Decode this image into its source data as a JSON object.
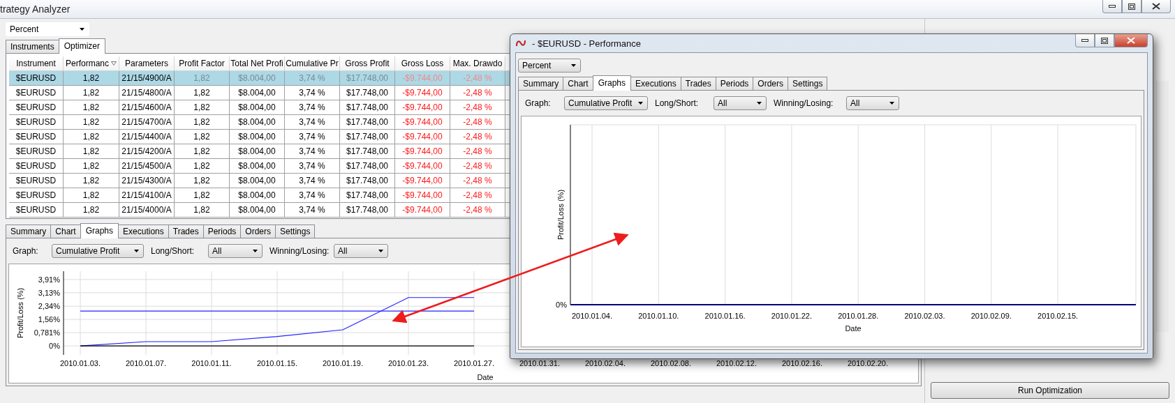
{
  "main_window": {
    "title": "trategy Analyzer",
    "display": "Percent",
    "top_tabs": [
      {
        "label": "Instruments",
        "selected": false
      },
      {
        "label": "Optimizer",
        "selected": true
      }
    ],
    "table": {
      "columns": [
        {
          "label": "Instrument",
          "sorted": false,
          "negative": false
        },
        {
          "label": "Performanc",
          "sorted": true,
          "negative": false
        },
        {
          "label": "Parameters",
          "sorted": false,
          "negative": false
        },
        {
          "label": "Profit Factor",
          "sorted": false,
          "negative": false
        },
        {
          "label": "Total Net Profi",
          "sorted": false,
          "negative": false
        },
        {
          "label": "Cumulative Pr",
          "sorted": false,
          "negative": false
        },
        {
          "label": "Gross Profit",
          "sorted": false,
          "negative": false
        },
        {
          "label": "Gross Loss",
          "sorted": false,
          "negative": true
        },
        {
          "label": "Max. Drawdo",
          "sorted": false,
          "negative": true
        }
      ],
      "rows": [
        {
          "selected": true,
          "cells": [
            "$EURUSD",
            "1,82",
            "21/15/4900/A",
            "1,82",
            "$8.004,00",
            "3,74 %",
            "$17.748,00",
            "-$9.744,00",
            "-2,48 %"
          ]
        },
        {
          "selected": false,
          "cells": [
            "$EURUSD",
            "1,82",
            "21/15/4800/A",
            "1,82",
            "$8.004,00",
            "3,74 %",
            "$17.748,00",
            "-$9.744,00",
            "-2,48 %"
          ]
        },
        {
          "selected": false,
          "cells": [
            "$EURUSD",
            "1,82",
            "21/15/4600/A",
            "1,82",
            "$8.004,00",
            "3,74 %",
            "$17.748,00",
            "-$9.744,00",
            "-2,48 %"
          ]
        },
        {
          "selected": false,
          "cells": [
            "$EURUSD",
            "1,82",
            "21/15/4700/A",
            "1,82",
            "$8.004,00",
            "3,74 %",
            "$17.748,00",
            "-$9.744,00",
            "-2,48 %"
          ]
        },
        {
          "selected": false,
          "cells": [
            "$EURUSD",
            "1,82",
            "21/15/4400/A",
            "1,82",
            "$8.004,00",
            "3,74 %",
            "$17.748,00",
            "-$9.744,00",
            "-2,48 %"
          ]
        },
        {
          "selected": false,
          "cells": [
            "$EURUSD",
            "1,82",
            "21/15/4200/A",
            "1,82",
            "$8.004,00",
            "3,74 %",
            "$17.748,00",
            "-$9.744,00",
            "-2,48 %"
          ]
        },
        {
          "selected": false,
          "cells": [
            "$EURUSD",
            "1,82",
            "21/15/4500/A",
            "1,82",
            "$8.004,00",
            "3,74 %",
            "$17.748,00",
            "-$9.744,00",
            "-2,48 %"
          ]
        },
        {
          "selected": false,
          "cells": [
            "$EURUSD",
            "1,82",
            "21/15/4300/A",
            "1,82",
            "$8.004,00",
            "3,74 %",
            "$17.748,00",
            "-$9.744,00",
            "-2,48 %"
          ]
        },
        {
          "selected": false,
          "cells": [
            "$EURUSD",
            "1,82",
            "21/15/4100/A",
            "1,82",
            "$8.004,00",
            "3,74 %",
            "$17.748,00",
            "-$9.744,00",
            "-2,48 %"
          ]
        },
        {
          "selected": false,
          "cells": [
            "$EURUSD",
            "1,82",
            "21/15/4000/A",
            "1,82",
            "$8.004,00",
            "3,74 %",
            "$17.748,00",
            "-$9.744,00",
            "-2,48 %"
          ]
        }
      ]
    },
    "bottom_tabs": [
      {
        "label": "Summary",
        "selected": false
      },
      {
        "label": "Chart",
        "selected": false
      },
      {
        "label": "Graphs",
        "selected": true
      },
      {
        "label": "Executions",
        "selected": false
      },
      {
        "label": "Trades",
        "selected": false
      },
      {
        "label": "Periods",
        "selected": false
      },
      {
        "label": "Orders",
        "selected": false
      },
      {
        "label": "Settings",
        "selected": false
      }
    ],
    "filters": [
      {
        "label": "Graph:",
        "value": "Cumulative Profit"
      },
      {
        "label": "Long/Short:",
        "value": "All"
      },
      {
        "label": "Winning/Losing:",
        "value": "All"
      }
    ],
    "chart": {
      "chart_data": {
        "type": "line",
        "xlabel": "Date",
        "ylabel": "Profit/Loss (%)",
        "grid": true,
        "x": [
          "2010.01.03.",
          "2010.01.07.",
          "2010.01.11.",
          "2010.01.15.",
          "2010.01.19.",
          "2010.01.23.",
          "2010.01.27.",
          "2010.01.31.",
          "2010.02.04.",
          "2010.02.08.",
          "2010.02.12.",
          "2010.02.16.",
          "2010.02.20."
        ],
        "series": [
          {
            "color": "#2020ff",
            "values": [
              0,
              0.25,
              0.25,
              0.55,
              0.95,
              2.85,
              2.85,
              null,
              null,
              null,
              null,
              null,
              null
            ]
          },
          {
            "color": "#2020ff",
            "values": [
              2.05,
              2.05,
              2.05,
              2.05,
              2.05,
              2.05,
              2.05,
              null,
              null,
              null,
              null,
              null,
              null
            ]
          },
          {
            "color": "#000000",
            "values": [
              0,
              0,
              0,
              0,
              0,
              0,
              0,
              null,
              null,
              null,
              null,
              null,
              null
            ]
          }
        ],
        "ylim": [
          -0.53,
          4.4
        ],
        "yticks": [
          {
            "value": 0,
            "label": "0%"
          },
          {
            "value": 0.781,
            "label": "0,781%"
          },
          {
            "value": 1.56,
            "label": "1,56%"
          },
          {
            "value": 2.34,
            "label": "2,34%"
          },
          {
            "value": 3.13,
            "label": "3,13%"
          },
          {
            "value": 3.91,
            "label": "3,91%"
          }
        ]
      }
    },
    "run_button": "Run Optimization"
  },
  "performance_window": {
    "title": " - $EURUSD - Performance",
    "display": "Percent",
    "tabs": [
      {
        "label": "Summary",
        "selected": false
      },
      {
        "label": "Chart",
        "selected": false
      },
      {
        "label": "Graphs",
        "selected": true
      },
      {
        "label": "Executions",
        "selected": false
      },
      {
        "label": "Trades",
        "selected": false
      },
      {
        "label": "Periods",
        "selected": false
      },
      {
        "label": "Orders",
        "selected": false
      },
      {
        "label": "Settings",
        "selected": false
      }
    ],
    "filters": [
      {
        "label": "Graph:",
        "value": "Cumulative Profit"
      },
      {
        "label": "Long/Short:",
        "value": "All"
      },
      {
        "label": "Winning/Losing:",
        "value": "All"
      }
    ],
    "chart": {
      "ylabel": "Profit/Loss (%)",
      "y_tick": "0%",
      "xlabel": "Date",
      "x_ticks": [
        "2010.01.04.",
        "2010.01.10.",
        "2010.01.16.",
        "2010.01.22.",
        "2010.01.28.",
        "2010.02.03.",
        "2010.02.09.",
        "2010.02.15."
      ]
    }
  }
}
